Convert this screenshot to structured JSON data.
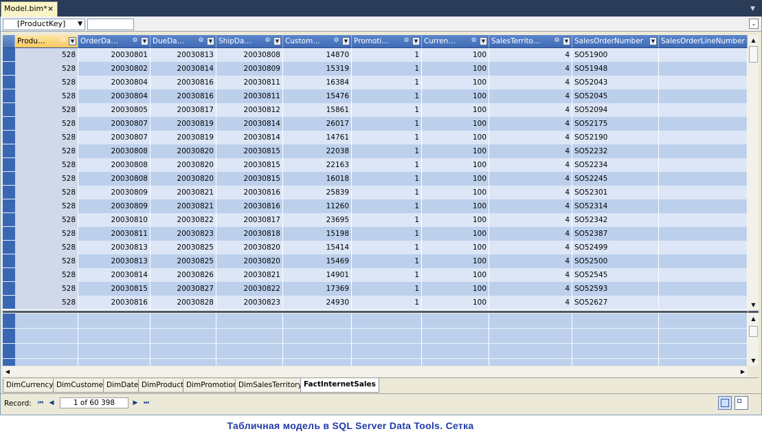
{
  "document_tab": {
    "title": "Model.bim*",
    "close_glyph": "×"
  },
  "formula_bar": {
    "column_selector": "[ProductKey]"
  },
  "grid": {
    "columns": [
      {
        "label": "Produ…",
        "align": "num"
      },
      {
        "label": "OrderDa…",
        "align": "num"
      },
      {
        "label": "DueDa…",
        "align": "num"
      },
      {
        "label": "ShipDa…",
        "align": "num"
      },
      {
        "label": "Custom…",
        "align": "num"
      },
      {
        "label": "Promoti…",
        "align": "num"
      },
      {
        "label": "Curren…",
        "align": "num"
      },
      {
        "label": "SalesTerrito…",
        "align": "num"
      },
      {
        "label": "SalesOrderNumber",
        "align": "text"
      },
      {
        "label": "SalesOrderLineNumber",
        "align": "text"
      }
    ],
    "rows": [
      [
        "528",
        "20030801",
        "20030813",
        "20030808",
        "14870",
        "1",
        "100",
        "4",
        "SO51900",
        ""
      ],
      [
        "528",
        "20030802",
        "20030814",
        "20030809",
        "15319",
        "1",
        "100",
        "4",
        "SO51948",
        ""
      ],
      [
        "528",
        "20030804",
        "20030816",
        "20030811",
        "16384",
        "1",
        "100",
        "4",
        "SO52043",
        ""
      ],
      [
        "528",
        "20030804",
        "20030816",
        "20030811",
        "15476",
        "1",
        "100",
        "4",
        "SO52045",
        ""
      ],
      [
        "528",
        "20030805",
        "20030817",
        "20030812",
        "15861",
        "1",
        "100",
        "4",
        "SO52094",
        ""
      ],
      [
        "528",
        "20030807",
        "20030819",
        "20030814",
        "26017",
        "1",
        "100",
        "4",
        "SO52175",
        ""
      ],
      [
        "528",
        "20030807",
        "20030819",
        "20030814",
        "14761",
        "1",
        "100",
        "4",
        "SO52190",
        ""
      ],
      [
        "528",
        "20030808",
        "20030820",
        "20030815",
        "22038",
        "1",
        "100",
        "4",
        "SO52232",
        ""
      ],
      [
        "528",
        "20030808",
        "20030820",
        "20030815",
        "22163",
        "1",
        "100",
        "4",
        "SO52234",
        ""
      ],
      [
        "528",
        "20030808",
        "20030820",
        "20030815",
        "16018",
        "1",
        "100",
        "4",
        "SO52245",
        ""
      ],
      [
        "528",
        "20030809",
        "20030821",
        "20030816",
        "25839",
        "1",
        "100",
        "4",
        "SO52301",
        ""
      ],
      [
        "528",
        "20030809",
        "20030821",
        "20030816",
        "11260",
        "1",
        "100",
        "4",
        "SO52314",
        ""
      ],
      [
        "528",
        "20030810",
        "20030822",
        "20030817",
        "23695",
        "1",
        "100",
        "4",
        "SO52342",
        ""
      ],
      [
        "528",
        "20030811",
        "20030823",
        "20030818",
        "15198",
        "1",
        "100",
        "4",
        "SO52387",
        ""
      ],
      [
        "528",
        "20030813",
        "20030825",
        "20030820",
        "15414",
        "1",
        "100",
        "4",
        "SO52499",
        ""
      ],
      [
        "528",
        "20030813",
        "20030825",
        "20030820",
        "15469",
        "1",
        "100",
        "4",
        "SO52500",
        ""
      ],
      [
        "528",
        "20030814",
        "20030826",
        "20030821",
        "14901",
        "1",
        "100",
        "4",
        "SO52545",
        ""
      ],
      [
        "528",
        "20030815",
        "20030827",
        "20030822",
        "17369",
        "1",
        "100",
        "4",
        "SO52593",
        ""
      ],
      [
        "528",
        "20030816",
        "20030828",
        "20030823",
        "24930",
        "1",
        "100",
        "4",
        "SO52627",
        ""
      ]
    ]
  },
  "sheet_tabs": [
    {
      "label": "DimCurrency",
      "active": false
    },
    {
      "label": "DimCustomer",
      "active": false
    },
    {
      "label": "DimDate",
      "active": false
    },
    {
      "label": "DimProduct",
      "active": false
    },
    {
      "label": "DimPromotion",
      "active": false
    },
    {
      "label": "DimSalesTerritory",
      "active": false
    },
    {
      "label": "FactInternetSales",
      "active": true
    }
  ],
  "status_bar": {
    "record_label": "Record:",
    "record_value": "1 of 60 398"
  },
  "caption": "Табличная модель в SQL Server Data Tools. Сетка",
  "colors": {
    "header_blue": "#4a76bf",
    "row_light": "#dce6f6",
    "row_dark": "#bcd0ec",
    "caption": "#1f3aa6"
  },
  "icons": [
    "close-icon",
    "dropdown-arrow-icon",
    "filter-icon",
    "scroll-up-icon",
    "scroll-down-icon",
    "first-record-icon",
    "prev-record-icon",
    "next-record-icon",
    "last-record-icon",
    "grid-view-icon",
    "diagram-view-icon"
  ]
}
